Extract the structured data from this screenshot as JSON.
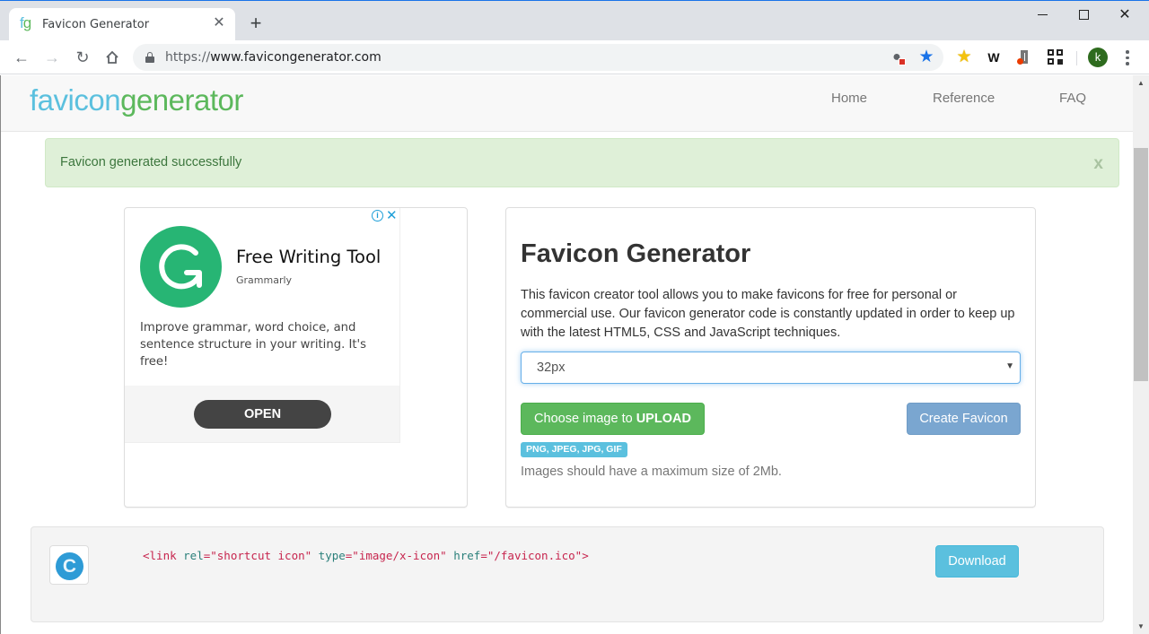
{
  "browser": {
    "tab": {
      "title": "Favicon Generator",
      "favicon_text_1": "f",
      "favicon_text_2": "g"
    },
    "new_tab_symbol": "+",
    "window_controls": [
      "minimize",
      "maximize",
      "close"
    ],
    "url": {
      "scheme": "https://",
      "host": "www.favicongenerator.com"
    },
    "omnibox_icons": [
      "cookie-blocked-icon",
      "bookmark-star-icon"
    ],
    "extensions": [
      "favorites-star-icon",
      "w-extension-icon",
      "office-icon",
      "qr-code-icon"
    ],
    "profile_initial": "k",
    "colors": {
      "accent": "#1a73e8",
      "avatar": "#2e6b1e"
    }
  },
  "site": {
    "logo": {
      "part1": "favicon",
      "part2": "generator"
    },
    "nav": [
      {
        "label": "Home"
      },
      {
        "label": "Reference"
      },
      {
        "label": "FAQ"
      }
    ],
    "alert": {
      "text": "Favicon generated successfully",
      "close_label": "x"
    },
    "ad": {
      "title": "Free Writing Tool",
      "advertiser": "Grammarly",
      "body": "Improve grammar, word choice, and sentence structure in your writing. It's free!",
      "cta": "OPEN",
      "info_symbol": "i",
      "close_symbol": "✕"
    },
    "generator": {
      "title": "Favicon Generator",
      "description": "This favicon creator tool allows you to make favicons for free for personal or commercial use. Our favicon generator code is constantly updated in order to keep up with the latest HTML5, CSS and JavaScript techniques.",
      "size_select": {
        "selected": "32px"
      },
      "upload_button": {
        "prefix": "Choose image to ",
        "emphasis": "UPLOAD"
      },
      "create_button": "Create Favicon",
      "formats_label": "PNG, JPEG, JPG, GIF",
      "size_note": "Images should have a maximum size of 2Mb."
    },
    "result": {
      "favicon_letter": "C",
      "code": {
        "open": "<link ",
        "attr1": "rel",
        "val1": "=\"shortcut icon\" ",
        "attr2": "type",
        "val2": "=\"image/x-icon\" ",
        "attr3": "href",
        "val3": "=\"/favicon.ico\">"
      },
      "download_button": "Download"
    },
    "colors": {
      "brand_blue": "#5bc0de",
      "brand_green": "#5cb85c",
      "alert_bg": "#dff0d8",
      "alert_text": "#3c763d",
      "create_button": "#7aa6d0",
      "grammarly_green": "#27b574"
    }
  }
}
